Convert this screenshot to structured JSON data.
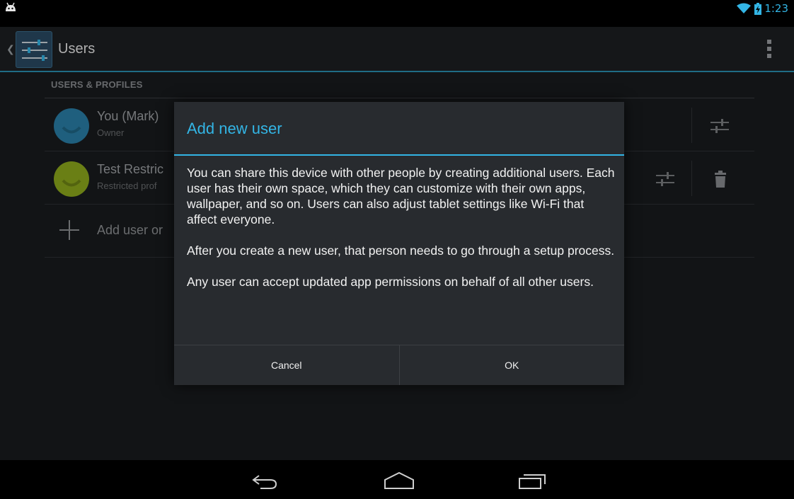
{
  "status_bar": {
    "time": "1:23",
    "icons": [
      "android-icon",
      "wifi-icon",
      "battery-charging-icon"
    ]
  },
  "action_bar": {
    "title": "Users",
    "icons": [
      "up-caret-icon",
      "settings-app-icon",
      "overflow-menu-icon"
    ]
  },
  "users_list": {
    "section_header": "USERS & PROFILES",
    "rows": [
      {
        "name": "You (Mark)",
        "subtitle": "Owner",
        "avatar_color": "#2a7fa8"
      },
      {
        "name": "Test Restric",
        "subtitle": "Restricted prof",
        "avatar_color": "#8eaa1d"
      }
    ],
    "add_label": "Add user or"
  },
  "dialog": {
    "title": "Add new user",
    "paragraphs": [
      "You can share this device with other people by creating additional users. Each user has their own space, which they can customize with their own apps, wallpaper, and so on. Users can also adjust tablet settings like Wi-Fi that affect everyone.",
      "After you create a new user, that person needs to go through a setup process.",
      "Any user can accept updated app permissions on behalf of all other users."
    ],
    "cancel_label": "Cancel",
    "ok_label": "OK"
  },
  "nav_bar": {
    "buttons": [
      "back-icon",
      "home-icon",
      "recents-icon"
    ]
  },
  "colors": {
    "accent": "#33b5e5",
    "background": "#181b1e",
    "dialog": "#282b2f"
  }
}
